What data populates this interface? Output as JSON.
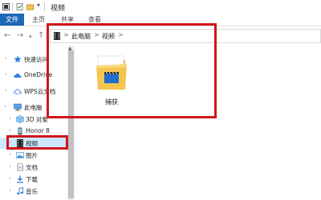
{
  "window": {
    "title": "视频"
  },
  "ribbon": {
    "tabs": [
      {
        "label": "文件"
      },
      {
        "label": "主页"
      },
      {
        "label": "共享"
      },
      {
        "label": "查看"
      }
    ]
  },
  "address": {
    "crumbs": [
      {
        "label": "此电脑"
      },
      {
        "label": "视频"
      }
    ],
    "separator": ">"
  },
  "sidebar": {
    "items": [
      {
        "label": "快速访问",
        "icon": "star-icon"
      },
      {
        "label": "OneDrive",
        "icon": "cloud-icon"
      },
      {
        "label": "WPS云文档",
        "icon": "cloud-icon"
      },
      {
        "label": "此电脑",
        "icon": "computer-icon"
      },
      {
        "label": "3D 对象",
        "icon": "cube-icon"
      },
      {
        "label": "Honor 8",
        "icon": "phone-icon"
      },
      {
        "label": "视频",
        "icon": "video-icon",
        "selected": true
      },
      {
        "label": "图片",
        "icon": "picture-icon"
      },
      {
        "label": "文档",
        "icon": "document-icon"
      },
      {
        "label": "下载",
        "icon": "download-icon"
      },
      {
        "label": "音乐",
        "icon": "music-icon"
      }
    ]
  },
  "content": {
    "items": [
      {
        "label": "捕获",
        "type": "folder",
        "icon": "video-folder-icon"
      }
    ]
  },
  "colors": {
    "accent": "#1e68b9",
    "selection": "#cce8ff",
    "highlight": "#d0151b",
    "folder": "#f5c550"
  }
}
